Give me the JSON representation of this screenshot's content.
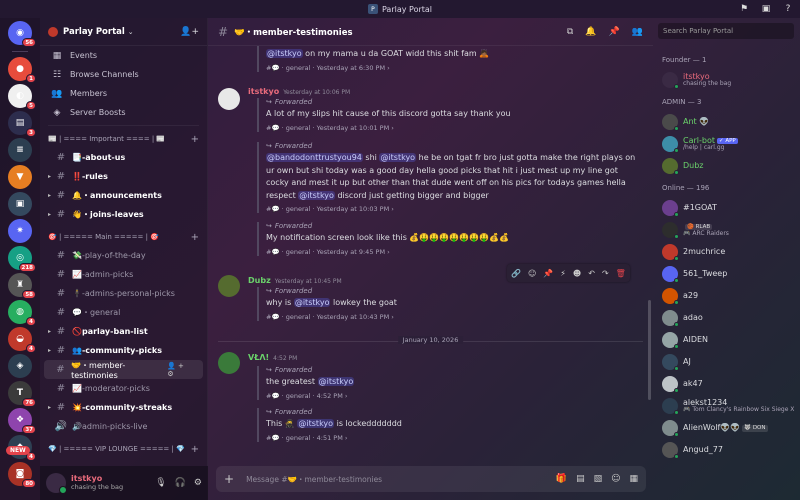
{
  "window": {
    "title": "Parlay Portal"
  },
  "rail": {
    "servers": [
      {
        "name": "discord-home",
        "badge": "56",
        "color": "#5865f2",
        "glyph": "◉"
      },
      {
        "name": "server-1",
        "badge": "1",
        "color": "#e74c3c",
        "glyph": "●"
      },
      {
        "name": "server-2",
        "badge": "5",
        "color": "#f0f0f0",
        "glyph": "◐"
      },
      {
        "name": "server-3",
        "badge": "3",
        "color": "#2d2d4d",
        "glyph": "▤"
      },
      {
        "name": "server-4",
        "badge": "",
        "color": "#2c3e50",
        "glyph": "≡"
      },
      {
        "name": "server-5",
        "badge": "",
        "color": "#e67e22",
        "glyph": "▼"
      },
      {
        "name": "server-6",
        "badge": "",
        "color": "#34495e",
        "glyph": "▣"
      },
      {
        "name": "server-7",
        "badge": "",
        "color": "#5865f2",
        "glyph": "✷"
      },
      {
        "name": "server-8",
        "badge": "218",
        "color": "#16a085",
        "glyph": "◎"
      },
      {
        "name": "server-9",
        "badge": "58",
        "color": "#555",
        "glyph": "♜"
      },
      {
        "name": "server-10",
        "badge": "4",
        "color": "#27ae60",
        "glyph": "◍"
      },
      {
        "name": "server-11",
        "badge": "4",
        "color": "#c0392b",
        "glyph": "◒"
      },
      {
        "name": "server-12",
        "badge": "",
        "color": "#2c3e50",
        "glyph": "◈"
      },
      {
        "name": "server-13",
        "badge": "76",
        "color": "#3b3b3b",
        "glyph": "T"
      },
      {
        "name": "server-14",
        "badge": "37",
        "color": "#8e44ad",
        "glyph": "❖"
      },
      {
        "name": "server-15",
        "badge": "4",
        "color": "#2e4053",
        "glyph": "◆"
      },
      {
        "name": "server-16",
        "badge": "80",
        "color": "#a93226",
        "glyph": "◙"
      }
    ],
    "new_label": "NEW"
  },
  "guild": {
    "name": "Parlay Portal"
  },
  "sidebar": {
    "nav": [
      {
        "label": "Events",
        "icon": "calendar-icon",
        "glyph": "▦"
      },
      {
        "label": "Browse Channels",
        "icon": "browse-channels-icon",
        "glyph": "☷"
      },
      {
        "label": "Members",
        "icon": "members-icon",
        "glyph": "👥"
      },
      {
        "label": "Server Boosts",
        "icon": "boost-icon",
        "glyph": "◈"
      }
    ],
    "categories": [
      {
        "label": "📰 | ==== Important ==== | 📰",
        "channels": [
          {
            "label": "📑-about-us",
            "unread": true,
            "arrow": false
          },
          {
            "label": "‼️-rules",
            "unread": true,
            "arrow": true
          },
          {
            "label": "🔔・announcements",
            "unread": true,
            "arrow": true,
            "prefix": "🔔"
          },
          {
            "label": "👋・joins-leaves",
            "unread": true,
            "arrow": true
          }
        ]
      },
      {
        "label": "🎯 | ===== Main ===== | 🎯",
        "channels": [
          {
            "label": "💸-play-of-the-day",
            "unread": false,
            "arrow": false
          },
          {
            "label": "📈-admin-picks",
            "unread": false,
            "arrow": false
          },
          {
            "label": "🕴️-admins-personal-picks",
            "unread": false,
            "arrow": false
          },
          {
            "label": "💬・general",
            "unread": false,
            "arrow": false
          },
          {
            "label": "🚫parlay-ban-list",
            "unread": true,
            "arrow": true
          },
          {
            "label": "👥-community-picks",
            "unread": true,
            "arrow": true
          },
          {
            "label": "🤝・member-testimonies",
            "unread": false,
            "arrow": false,
            "active": true
          },
          {
            "label": "📈-moderator-picks",
            "unread": false,
            "arrow": false
          },
          {
            "label": "💥-community-streaks",
            "unread": true,
            "arrow": true
          },
          {
            "label": "🔊admin-picks-live",
            "unread": false,
            "arrow": false,
            "voice": true
          }
        ]
      },
      {
        "label": "💎 | ===== VIP LOUNGE ===== | 💎",
        "channels": []
      }
    ]
  },
  "user": {
    "name": "itstkyo",
    "status": "chasing the bag"
  },
  "header": {
    "channel": "🤝・member-testimonies"
  },
  "search": {
    "placeholder": "Search Parlay Portal"
  },
  "messages": {
    "m0": {
      "text_pre": "",
      "mention": "@itstkyo",
      "text": " on my mama u da GOAT widd this shit fam 🙇🏾",
      "meta": "#💬 · general · Yesterday at 6:30 PM ›"
    },
    "m1": {
      "author": "itstkyo",
      "time": "Yesterday at 10:06 PM",
      "color": "#e96b7c",
      "f1": {
        "label": "Forwarded",
        "text": "A lot of my slips hit cause of this discord gotta say thank you",
        "meta": "#💬 · general · Yesterday at 10:01 PM ›"
      },
      "f2": {
        "label": "Forwarded",
        "m1": "@bandodonttrustyou94",
        "t1": " shi ",
        "m2": "@itstkyo",
        "t2": " he be on tgat fr bro just gotta make the right plays on ur own but shi today was a good day hella good picks that hit i just mest up my line got cocky and mest it up but other than that dude went off on his pics for todays games hella respect ",
        "m3": "@itstkyo",
        "t3": " discord just getting bigger and bigger",
        "meta": "#💬 · general · Yesterday at 10:03 PM ›"
      },
      "f3": {
        "label": "Forwarded",
        "text": "My notification screen look like this 💰🤑🤑🤑🤑🤑🤑🤑💰💰",
        "meta": "#💬 · general · Yesterday at 9:45 PM ›"
      }
    },
    "m2": {
      "author": "Dubz",
      "time": "Yesterday at 10:45 PM",
      "color": "#6bd36b",
      "f1": {
        "label": "Forwarded",
        "t1": "why is ",
        "mention": "@itstkyo",
        "t2": " lowkey the goat",
        "meta": "#💬 · general · Yesterday at 10:43 PM ›"
      }
    },
    "date_sep": "January 10, 2026",
    "m3": {
      "author": "VŁΛ!",
      "time": "4:52 PM",
      "color": "#6bd36b",
      "f1": {
        "label": "Forwarded",
        "t1": "the greatest ",
        "mention": "@itstkyo",
        "meta": "#💬 · general · 4:52 PM ›"
      },
      "f2": {
        "label": "Forwarded",
        "t1": "This 🥷 ",
        "mention": "@itstkyo",
        "t2": " is lockeddddddd",
        "meta": "#💬 · general · 4:51 PM ›"
      }
    }
  },
  "composer": {
    "placeholder": "Message #🤝・member-testimonies"
  },
  "members": {
    "founder_header": "Founder — 1",
    "admin_header": "ADMIN — 3",
    "online_header": "Online — 196",
    "founder": [
      {
        "name": "itstkyo",
        "sub": "chasing the bag",
        "color": "#e96b7c",
        "av": "#3a2a44"
      }
    ],
    "admins": [
      {
        "name": "Ant 👽",
        "sub": "",
        "color": "#6bd36b",
        "av": "#4a4a4a"
      },
      {
        "name": "Carl-bot",
        "tag": "✓ APP",
        "sub": "/help | carl.gg",
        "color": "#6bd36b",
        "av": "#3d8ea8"
      },
      {
        "name": "Dubz",
        "sub": "",
        "color": "#6bd36b",
        "av": "#556b2f"
      }
    ],
    "online": [
      {
        "name": "#1GOAT",
        "sub": "",
        "av": "#6b3f8e"
      },
      {
        "name": "",
        "tag": "🏀 RLAB",
        "sub": "🎮 ARC Raiders",
        "av": "#2d2d2d"
      },
      {
        "name": "2muchrice",
        "sub": "",
        "av": "#c0392b"
      },
      {
        "name": "561_Tweep",
        "sub": "",
        "av": "#5865f2"
      },
      {
        "name": "a29",
        "sub": "",
        "av": "#d35400"
      },
      {
        "name": "adao",
        "sub": "",
        "av": "#7f8c8d"
      },
      {
        "name": "AIDEN",
        "sub": "",
        "av": "#95a5a6"
      },
      {
        "name": "AJ",
        "sub": "",
        "av": "#34495e"
      },
      {
        "name": "ak47",
        "sub": "",
        "av": "#bdc3c7"
      },
      {
        "name": "alekst1234",
        "sub": "🎮 Tom Clancy's Rainbow Six Siege X",
        "av": "#2c3e50"
      },
      {
        "name": "AlienWolf👽👽",
        "tag": "🐺 DON",
        "sub": "",
        "av": "#7f8c8d"
      },
      {
        "name": "Angud_77",
        "sub": "",
        "av": "#555"
      }
    ]
  }
}
